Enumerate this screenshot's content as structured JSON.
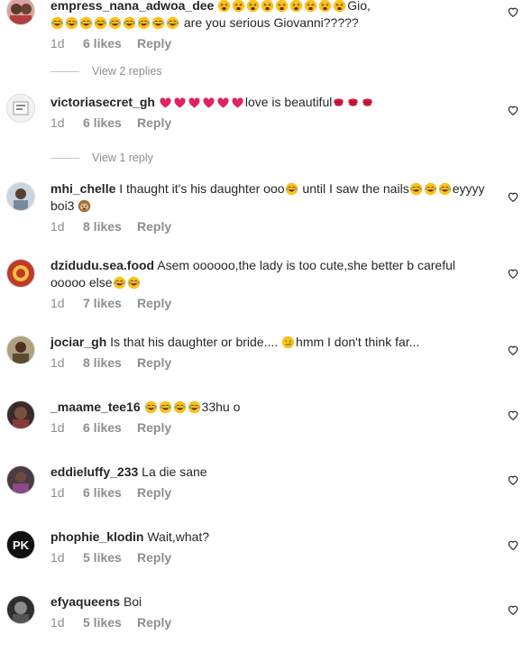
{
  "comments": [
    {
      "username": "empress_nana_adwoa_dee",
      "pre_emojis": [
        "weary-face",
        "weary-face",
        "weary-face",
        "weary-face",
        "weary-face",
        "weary-face",
        "weary-face",
        "weary-face",
        "weary-face"
      ],
      "text_a": "Gio,",
      "mid_emojis": [
        "laughing-tears",
        "laughing-tears",
        "laughing-tears",
        "laughing-tears",
        "laughing-tears",
        "laughing-tears",
        "laughing-tears",
        "laughing-tears",
        "laughing-tears"
      ],
      "text_b": " are you serious Giovanni?????",
      "age": "1d",
      "likes": "6 likes",
      "reply": "Reply",
      "avatar_color": "#c07a6a"
    },
    {
      "username": "victoriasecret_gh",
      "pre_emojis": [
        "red-heart",
        "red-heart",
        "red-heart",
        "red-heart",
        "red-heart",
        "red-heart"
      ],
      "text_a": "love is beautiful",
      "post_emojis": [
        "kiss-mark",
        "kiss-mark",
        "kiss-mark"
      ],
      "age": "1d",
      "likes": "6 likes",
      "reply": "Reply",
      "avatar_color": "#e8e8e8"
    },
    {
      "username": "mhi_chelle",
      "text_a": "I thaught it's his daughter ooo",
      "emo1": [
        "laughing-tears"
      ],
      "text_b": " until I saw the nails",
      "emo2": [
        "laughing-tears",
        "laughing-tears",
        "laughing-tears"
      ],
      "text_c": "eyyyy boi3",
      "emo3": [
        "hear-no-evil"
      ],
      "age": "1d",
      "likes": "8 likes",
      "reply": "Reply",
      "avatar_color": "#8aa0b8"
    },
    {
      "username": "dzidudu.sea.food",
      "text_a": "Asem oooooo,the lady is too cute,she better b careful ooooo else",
      "emo1": [
        "laughing-tears",
        "laughing-tears"
      ],
      "age": "1d",
      "likes": "7 likes",
      "reply": "Reply",
      "avatar_color": "#c0392b"
    },
    {
      "username": "jociar_gh",
      "text_a": "Is that his daughter or bride.... ",
      "emo1": [
        "crying-face"
      ],
      "text_b": "hmm I don't think far...",
      "age": "1d",
      "likes": "8 likes",
      "reply": "Reply",
      "avatar_color": "#6b5a3a"
    },
    {
      "username": "_maame_tee16",
      "emo1": [
        "laughing-tears",
        "laughing-tears",
        "laughing-tears",
        "laughing-tears"
      ],
      "text_a": "33hu o",
      "age": "1d",
      "likes": "6 likes",
      "reply": "Reply",
      "avatar_color": "#5a3a3a"
    },
    {
      "username": "eddieluffy_233",
      "text_a": "La die sane",
      "age": "1d",
      "likes": "6 likes",
      "reply": "Reply",
      "avatar_color": "#4a3a44"
    },
    {
      "username": "phophie_klodin",
      "text_a": "Wait,what?",
      "age": "1d",
      "likes": "5 likes",
      "reply": "Reply",
      "avatar_color": "#111111",
      "avatar_logo": "PK"
    },
    {
      "username": "efyaqueens",
      "text_a": "Boi",
      "age": "1d",
      "likes": "5 likes",
      "reply": "Reply",
      "avatar_color": "#3a3a3a"
    }
  ],
  "view_replies": [
    "View 2 replies",
    "View 1 reply"
  ]
}
